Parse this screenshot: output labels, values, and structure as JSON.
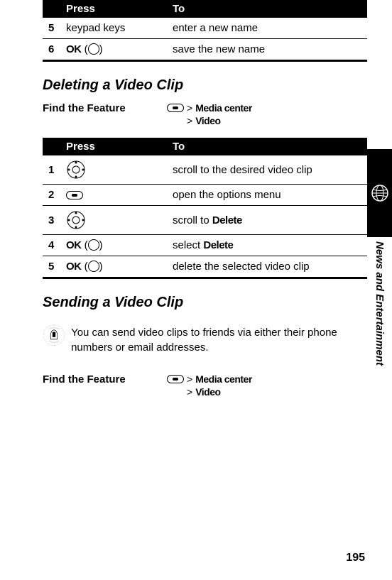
{
  "table1": {
    "headers": {
      "press": "Press",
      "to": "To"
    },
    "rows": [
      {
        "num": "5",
        "press": "keypad keys",
        "to": "enter a new name"
      },
      {
        "num": "6",
        "press_prefix": "OK",
        "to": "save the new name"
      }
    ]
  },
  "section1": {
    "heading": "Deleting a Video Clip",
    "feature_label": "Find the Feature",
    "path1_gt": ">",
    "path1": "Media center",
    "path2_gt": ">",
    "path2": "Video"
  },
  "table2": {
    "headers": {
      "press": "Press",
      "to": "To"
    },
    "rows": [
      {
        "num": "1",
        "to": "scroll to the desired video clip"
      },
      {
        "num": "2",
        "to": "open the options menu"
      },
      {
        "num": "3",
        "to_prefix": "scroll to",
        "to_bold": "Delete"
      },
      {
        "num": "4",
        "press_prefix": "OK",
        "to_prefix": "select",
        "to_bold": "Delete"
      },
      {
        "num": "5",
        "press_prefix": "OK",
        "to": "delete the selected video clip"
      }
    ]
  },
  "section2": {
    "heading": "Sending a Video Clip",
    "body": "You can send video clips to friends via either their phone numbers or email addresses.",
    "feature_label": "Find the Feature",
    "path1_gt": ">",
    "path1": "Media center",
    "path2_gt": ">",
    "path2": "Video"
  },
  "sidebar_text": "News and Entertainment",
  "page_number": "195"
}
